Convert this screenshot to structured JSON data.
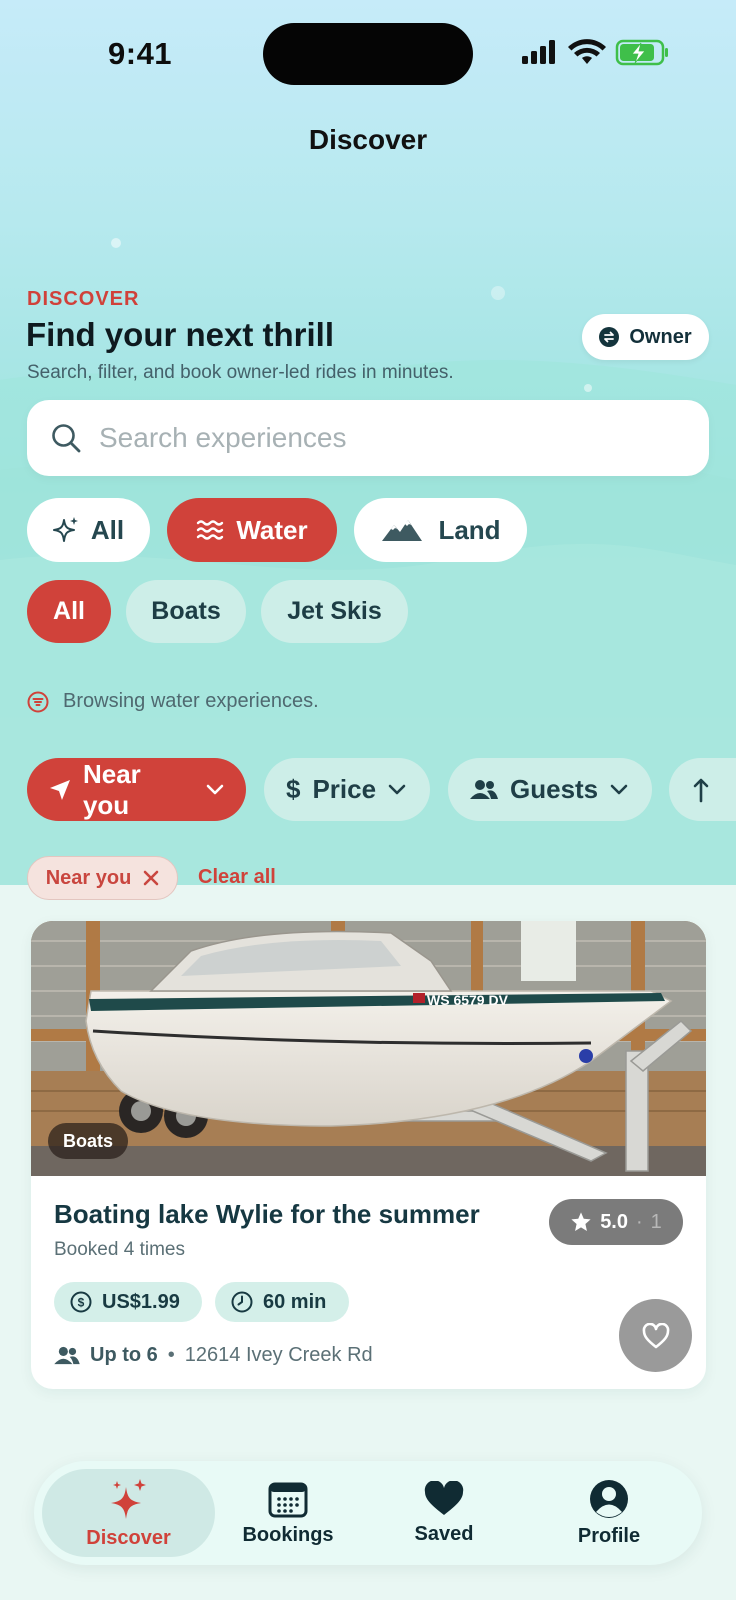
{
  "status_bar": {
    "time": "9:41"
  },
  "nav": {
    "title": "Discover"
  },
  "hero": {
    "eyebrow": "DISCOVER",
    "headline": "Find your next thrill",
    "subline": "Search, filter, and book owner-led rides in minutes.",
    "owner_button": "Owner"
  },
  "search": {
    "placeholder": "Search experiences",
    "value": ""
  },
  "categories": [
    {
      "label": "All",
      "icon": "sparkle-icon",
      "selected": false
    },
    {
      "label": "Water",
      "icon": "waves-icon",
      "selected": true
    },
    {
      "label": "Land",
      "icon": "mountains-icon",
      "selected": false
    }
  ],
  "subcategories": [
    {
      "label": "All",
      "selected": true
    },
    {
      "label": "Boats",
      "selected": false
    },
    {
      "label": "Jet Skis",
      "selected": false
    }
  ],
  "info": {
    "text": "Browsing water experiences.",
    "icon": "filter-circle-icon"
  },
  "filters": [
    {
      "label": "Near you",
      "icon": "location-arrow-icon",
      "active": true
    },
    {
      "label": "Price",
      "icon": "dollar-icon",
      "active": false
    },
    {
      "label": "Guests",
      "icon": "people-icon",
      "active": false
    },
    {
      "label": "",
      "icon": "sort-arrow-icon",
      "active": false
    }
  ],
  "active_chips": [
    {
      "label": "Near you"
    }
  ],
  "clear_all": "Clear all",
  "listing": {
    "category_badge": "Boats",
    "title": "Boating lake Wylie for the summer",
    "subtitle": "Booked 4 times",
    "rating": "5.0",
    "rating_separator": "·",
    "review_count": "1",
    "price": "US$1.99",
    "duration": "60 min",
    "guests": "Up to 6",
    "meta_separator": "•",
    "address": "12614 Ivey Creek Rd",
    "hull_registration": "WS 6579 DV"
  },
  "tabbar": {
    "discover": "Discover",
    "bookings": "Bookings",
    "saved": "Saved",
    "profile": "Profile"
  },
  "colors": {
    "accent": "#d0423a",
    "chip_bg": "#cdeee8",
    "text_dark": "#13303a"
  }
}
